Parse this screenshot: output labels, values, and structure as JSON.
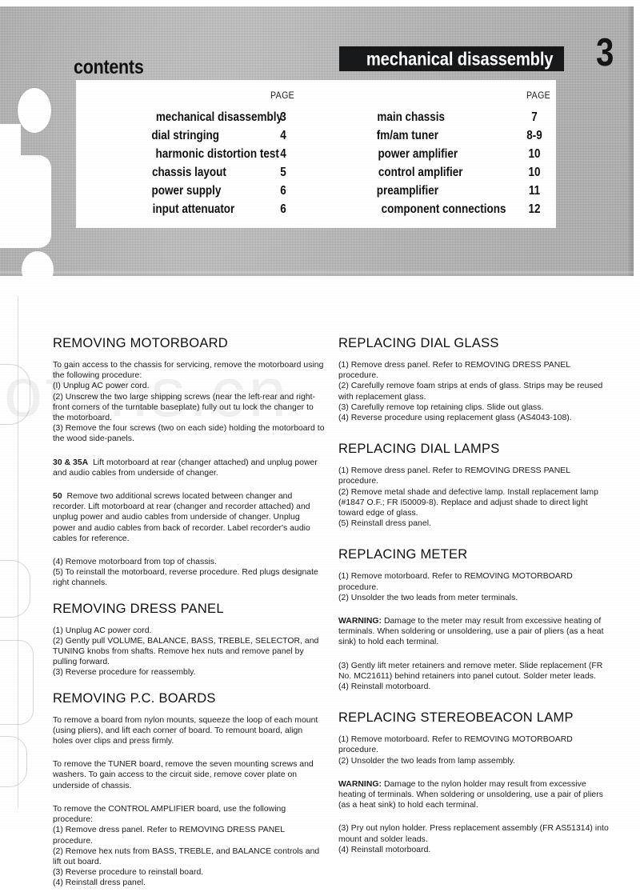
{
  "header": {
    "contents_label": "contents",
    "banner_title": "mechanical disassembly",
    "page_number": "3"
  },
  "watermark": {
    "text": "iofans.cn"
  },
  "contents": {
    "page_header_left": "PAGE",
    "page_header_right": "PAGE",
    "left_entries": [
      {
        "title": "mechanical disassembly",
        "page": "3"
      },
      {
        "title": "dial stringing",
        "page": "4"
      },
      {
        "title": "harmonic distortion test",
        "page": "4"
      },
      {
        "title": "chassis layout",
        "page": "5"
      },
      {
        "title": "power supply",
        "page": "6"
      },
      {
        "title": "input attenuator",
        "page": "6"
      }
    ],
    "right_entries": [
      {
        "title": "main chassis",
        "page": "7"
      },
      {
        "title": "fm/am tuner",
        "page": "8-9"
      },
      {
        "title": "power amplifier",
        "page": "10"
      },
      {
        "title": "control amplifier",
        "page": "10"
      },
      {
        "title": "preamplifier",
        "page": "11"
      },
      {
        "title": "component connections",
        "page": "12"
      }
    ]
  },
  "left_column": {
    "s1": {
      "heading": "REMOVING MOTORBOARD",
      "p1": "To gain access to the chassis for servicing, remove the motorboard using the following procedure:",
      "p2": "(I) Unplug AC power cord.",
      "p3": "(2) Unscrew the two large shipping screws (near the left-rear and right-front corners of the turntable baseplate) fully out tu lock the changer to the motorboard.",
      "p4": "(3) Remove the four screws (two on each side) holding the motorboard to the wood side-panels.",
      "p5_bold": "30 & 35A",
      "p5": "Lift motorboard at rear (changer attached) and unplug power and audio cables from underside of changer.",
      "p6_bold": "50",
      "p6": "Remove two additional screws located between changer and recorder. Lift motorboard at rear (changer and recorder attached) and unplug power and audio cables from underside of changer. Unplug power and audio cables from back of recorder. Label recorder's audio cables for reference.",
      "p7": "(4) Remove motorboard from top of chassis.",
      "p8": "(5) To reinstall the motorboard, reverse procedure. Red plugs designate right channels."
    },
    "s2": {
      "heading": "REMOVING DRESS PANEL",
      "p1": "(1) Unplug AC power cord.",
      "p2": "(2) Gently pull VOLUME, BALANCE, BASS, TREBLE, SELECTOR, and TUNING knobs from shafts. Remove hex nuts and remove panel by pulling forward.",
      "p3": "(3) Reverse procedure for reassembly."
    },
    "s3": {
      "heading": "REMOVING P.C. BOARDS",
      "p1": "To remove a board from nylon mounts, squeeze the loop of each mount (using pliers), and lift each corner of board. To remount board, align holes over clips and press firmly.",
      "p2": "To remove the TUNER board, remove the seven mounting screws and washers. To gain access to the circuit side, remove cover plate on underside of chassis.",
      "p3": "To remove the CONTROL AMPLIFIER board, use the following procedure:",
      "p4": "(1) Remove dress panel. Refer to REMOVING DRESS PANEL procedure.",
      "p5": "(2) Remove hex nuts from BASS, TREBLE, and BALANCE controls and lift out board.",
      "p6": "(3) Reverse procedure to reinstall board.",
      "p7": "(4) Reinstall dress panel."
    }
  },
  "right_column": {
    "s1": {
      "heading": "REPLACING DIAL GLASS",
      "p1": "(1) Remove dress panel. Refer to REMOVING DRESS PANEL procedure.",
      "p2": "(2) Carefully remove foam strips at ends of glass. Strips may be reused with replacement glass.",
      "p3": "(3) Carefully remove top retaining clips. Slide out glass.",
      "p4": "(4) Reverse procedure using replacement glass (AS4043-108)."
    },
    "s2": {
      "heading": "REPLACING DIAL LAMPS",
      "p1": "(1) Remove dress panel. Refer to REMOVING DRESS PANEL procedure.",
      "p2": "(2) Remove metal shade and defective lamp. Install replacement lamp (#1847 O.F.; FR I50009-8). Replace and adjust shade to direct light toward edge of glass.",
      "p3": "(5) Reinstall dress panel."
    },
    "s3": {
      "heading": "REPLACING METER",
      "p1": "(1) Remove motorboard. Refer to REMOVING MOTORBOARD procedure.",
      "p2": "(2) Unsolder the two leads from meter terminals.",
      "warning_label": "WARNING:",
      "p3": "Damage to the meter may result from excessive heating of terminals. When soldering or unsoldering, use a pair of pliers (as a heat sink) to hold each terminal.",
      "p4": "(3) Gently lift meter retainers and remove meter. Slide replacement (FR No. MC21611) behind retainers into panel cutout. Solder meter leads.",
      "p5": "(4) Reinstall motorboard."
    },
    "s4": {
      "heading": "REPLACING STEREOBEACON LAMP",
      "p1": "(1) Remove motorboard. Refer to REMOVING MOTORBOARD procedure.",
      "p2": "(2) Unsolder the two leads from lamp assembly.",
      "warning_label": "WARNING:",
      "p3": "Damage to the nylon holder may result from excessive heating of terminals. When soldering or unsoldering, use a pair of pliers (as a heat sink) to hold each terminal.",
      "p4": "(3) Pry out nylon holder. Press replacement assembly (FR AS51314) into mount and solder leads.",
      "p5": "(4) Reinstall motorboard."
    }
  }
}
